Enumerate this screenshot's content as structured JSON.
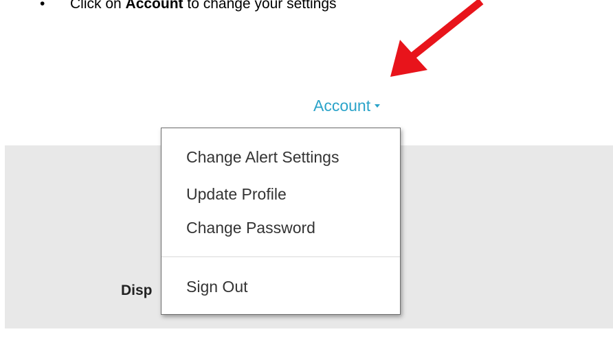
{
  "instruction": {
    "bullet": "•",
    "prefix": "Click on ",
    "emphasis": "Account",
    "suffix": " to change your settings"
  },
  "annotation": {
    "arrow_color": "#e8141b",
    "arrow_icon": "red-arrow-icon"
  },
  "account_menu": {
    "label": "Account",
    "caret_icon": "caret-down-icon",
    "color": "#2aa3c9",
    "items": [
      {
        "label": "Change Alert Settings"
      },
      {
        "label": "Update Profile"
      },
      {
        "label": "Change Password"
      }
    ],
    "sign_out": {
      "label": "Sign Out"
    }
  },
  "page": {
    "partial_label": "Disp"
  }
}
